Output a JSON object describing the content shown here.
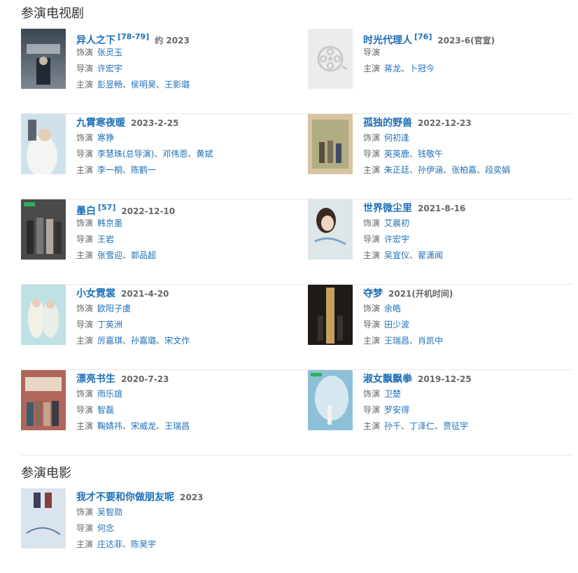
{
  "tv_section": {
    "title": "参演电视剧",
    "items": [
      {
        "title": "异人之下",
        "ref": "[78-79]",
        "date": "约 2023",
        "roles": [
          {
            "k": "饰演",
            "v": [
              "张灵玉"
            ]
          },
          {
            "k": "导演",
            "v": [
              "许宏宇"
            ]
          },
          {
            "k": "主演",
            "v": [
              "彭昱畅",
              "侯明昊",
              "王影璐"
            ]
          }
        ]
      },
      {
        "title": "时光代理人",
        "ref": "[76]",
        "date": "2023-6(官宣)",
        "roles": [
          {
            "k": "导演",
            "v": []
          },
          {
            "k": "主演",
            "v": [
              "蒋龙",
              "卜冠今"
            ]
          }
        ],
        "placeholder": true
      },
      {
        "title": "九霄寒夜暖",
        "ref": "",
        "date": "2023-2-25",
        "roles": [
          {
            "k": "饰演",
            "v": [
              "寒狰"
            ]
          },
          {
            "k": "导演",
            "v": [
              "李慧珠(总导演)",
              "邓伟恩",
              "黄斌"
            ]
          },
          {
            "k": "主演",
            "v": [
              "李一桐",
              "陈鹤一"
            ]
          }
        ]
      },
      {
        "title": "孤独的野兽",
        "ref": "",
        "date": "2022-12-23",
        "roles": [
          {
            "k": "饰演",
            "v": [
              "何初逢"
            ]
          },
          {
            "k": "导演",
            "v": [
              "英英鹿",
              "钱敬午"
            ]
          },
          {
            "k": "主演",
            "v": [
              "朱正廷",
              "孙伊涵",
              "张柏嘉",
              "段奕娟"
            ]
          }
        ]
      },
      {
        "title": "墨白",
        "ref": "[57]",
        "date": "2022-12-10",
        "roles": [
          {
            "k": "饰演",
            "v": [
              "韩京墨"
            ]
          },
          {
            "k": "导演",
            "v": [
              "王岩"
            ]
          },
          {
            "k": "主演",
            "v": [
              "张雪迎",
              "郭品超"
            ]
          }
        ]
      },
      {
        "title": "世界微尘里",
        "ref": "",
        "date": "2021-8-16",
        "roles": [
          {
            "k": "饰演",
            "v": [
              "艾晨初"
            ]
          },
          {
            "k": "导演",
            "v": [
              "许宏宇"
            ]
          },
          {
            "k": "主演",
            "v": [
              "吴宣仪",
              "翟潇闻"
            ]
          }
        ]
      },
      {
        "title": "小女霓裳",
        "ref": "",
        "date": "2021-4-20",
        "roles": [
          {
            "k": "饰演",
            "v": [
              "欧阳子虞"
            ]
          },
          {
            "k": "导演",
            "v": [
              "丁英洲"
            ]
          },
          {
            "k": "主演",
            "v": [
              "厉嘉琪",
              "孙嘉璐",
              "宋文作"
            ]
          }
        ]
      },
      {
        "title": "夺梦",
        "ref": "",
        "date": "2021(开机时间)",
        "roles": [
          {
            "k": "饰演",
            "v": [
              "余皓"
            ]
          },
          {
            "k": "导演",
            "v": [
              "田少波"
            ]
          },
          {
            "k": "主演",
            "v": [
              "王瑞昌",
              "肖凯中"
            ]
          }
        ]
      },
      {
        "title": "漂亮书生",
        "ref": "",
        "date": "2020-7-23",
        "roles": [
          {
            "k": "饰演",
            "v": [
              "雨乐誼"
            ]
          },
          {
            "k": "导演",
            "v": [
              "智磊"
            ]
          },
          {
            "k": "主演",
            "v": [
              "鞠婧祎",
              "宋威龙",
              "王瑞昌"
            ]
          }
        ]
      },
      {
        "title": "淑女飘飘拳",
        "ref": "",
        "date": "2019-12-25",
        "roles": [
          {
            "k": "饰演",
            "v": [
              "卫楚"
            ]
          },
          {
            "k": "导演",
            "v": [
              "罗安得"
            ]
          },
          {
            "k": "主演",
            "v": [
              "孙千",
              "丁泽仁",
              "贾征宇"
            ]
          }
        ]
      }
    ]
  },
  "movie_section": {
    "title": "参演电影",
    "items": [
      {
        "title": "我才不要和你做朋友呢",
        "ref": "",
        "date": "2023",
        "roles": [
          {
            "k": "饰演",
            "v": [
              "吴智勋"
            ]
          },
          {
            "k": "导演",
            "v": [
              "何念"
            ]
          },
          {
            "k": "主演",
            "v": [
              "庄达菲",
              "陈昊宇"
            ]
          }
        ]
      }
    ]
  },
  "colors": {
    "link": "#1d6fb8",
    "label": "#666666",
    "divider": "#e8e8e8"
  }
}
